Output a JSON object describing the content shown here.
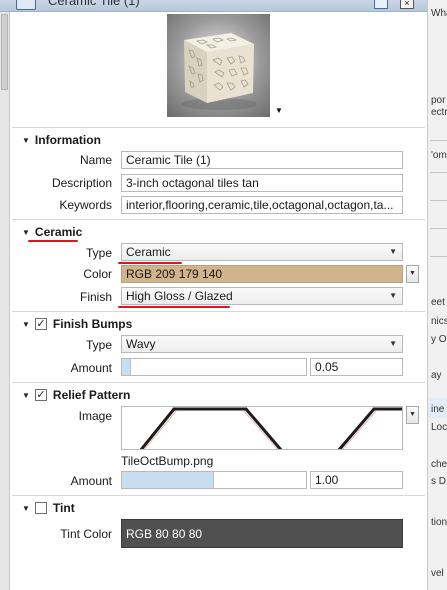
{
  "window": {
    "title": "Ceramic Tile (1)"
  },
  "preview": {
    "alt": "material preview sphere"
  },
  "information": {
    "header": "Information",
    "name_label": "Name",
    "name_value": "Ceramic Tile (1)",
    "description_label": "Description",
    "description_value": "3-inch octagonal tiles tan",
    "keywords_label": "Keywords",
    "keywords_value": "interior,flooring,ceramic,tile,octagonal,octagon,ta..."
  },
  "ceramic": {
    "header": "Ceramic",
    "type_label": "Type",
    "type_value": "Ceramic",
    "color_label": "Color",
    "color_value": "RGB 209 179 140",
    "color_hex": "#d1b38c",
    "finish_label": "Finish",
    "finish_value": "High Gloss / Glazed"
  },
  "finish_bumps": {
    "header": "Finish Bumps",
    "enabled": true,
    "type_label": "Type",
    "type_value": "Wavy",
    "amount_label": "Amount",
    "amount_value": "0.05",
    "amount_fraction": 0.05
  },
  "relief_pattern": {
    "header": "Relief Pattern",
    "enabled": true,
    "image_label": "Image",
    "image_file": "TileOctBump.png",
    "amount_label": "Amount",
    "amount_value": "1.00",
    "amount_fraction": 0.5
  },
  "tint": {
    "header": "Tint",
    "enabled": false,
    "color_label": "Tint Color",
    "color_value": "RGB 80 80 80",
    "color_hex": "#505050"
  },
  "background_panel": {
    "fragments": [
      "Wha",
      "por",
      "ectr",
      "'om",
      "eet",
      "nics",
      "y O",
      "ay",
      "ine",
      "Loc",
      "che",
      "s D",
      "tion",
      "vel"
    ]
  },
  "colors": {
    "annotation_red": "#e0141e",
    "slider_fill": "#c9ddf0"
  }
}
